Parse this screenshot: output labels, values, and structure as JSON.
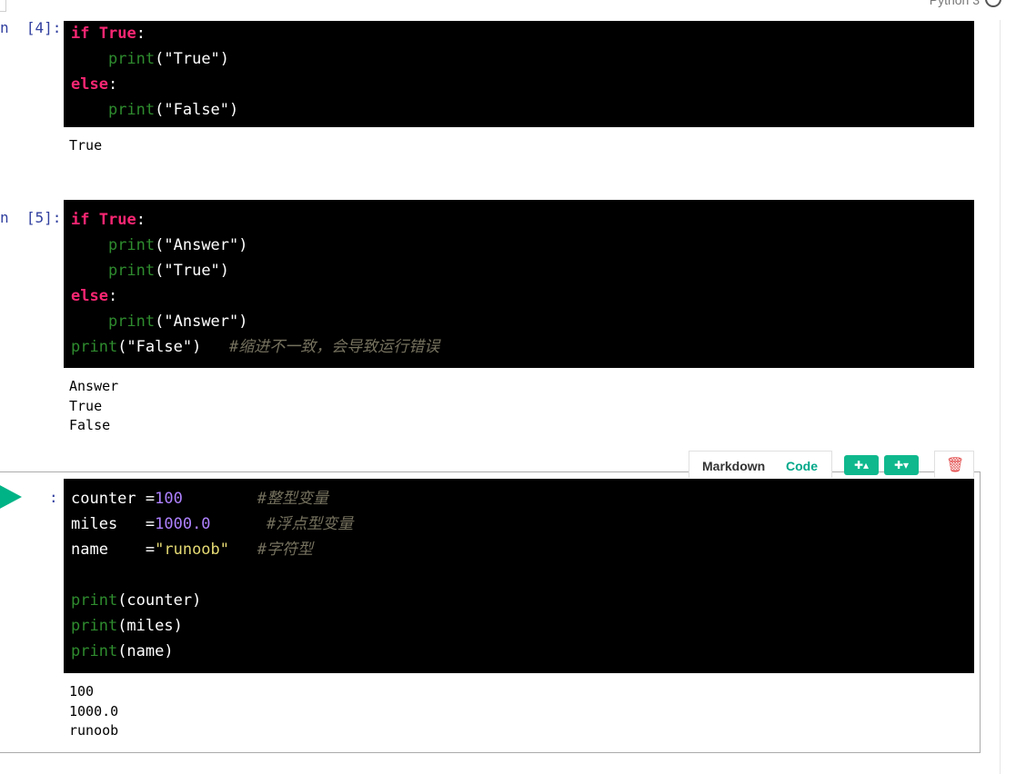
{
  "kernel": {
    "name": "Python 3"
  },
  "cells": [
    {
      "prompt": "n  [4]:",
      "code": [
        [
          [
            "kw",
            "if"
          ],
          [
            "punc",
            " "
          ],
          [
            "kw",
            "True"
          ],
          [
            "punc",
            ":"
          ]
        ],
        [
          [
            "punc",
            "    "
          ],
          [
            "fn",
            "print"
          ],
          [
            "punc",
            "(\"True\")"
          ]
        ],
        [
          [
            "kw",
            "else"
          ],
          [
            "punc",
            ":"
          ]
        ],
        [
          [
            "punc",
            "    "
          ],
          [
            "fn",
            "print"
          ],
          [
            "punc",
            "(\"False\")"
          ]
        ]
      ],
      "output": [
        "True"
      ]
    },
    {
      "prompt": "n  [5]:",
      "code": [
        [
          [
            "kw",
            "if"
          ],
          [
            "punc",
            " "
          ],
          [
            "kw",
            "True"
          ],
          [
            "punc",
            ":"
          ]
        ],
        [
          [
            "punc",
            "    "
          ],
          [
            "fn",
            "print"
          ],
          [
            "punc",
            "(\"Answer\")"
          ]
        ],
        [
          [
            "punc",
            "    "
          ],
          [
            "fn",
            "print"
          ],
          [
            "punc",
            "(\"True\")"
          ]
        ],
        [
          [
            "kw",
            "else"
          ],
          [
            "punc",
            ":"
          ]
        ],
        [
          [
            "punc",
            "    "
          ],
          [
            "fn",
            "print"
          ],
          [
            "punc",
            "(\"Answer\")"
          ]
        ],
        [
          [
            "fn",
            "print"
          ],
          [
            "punc",
            "(\"False\")   "
          ],
          [
            "cmt",
            "#缩进不一致，会导致运行错误"
          ]
        ]
      ],
      "output": [
        "Answer",
        "True",
        "False"
      ]
    },
    {
      "prompt": ":",
      "code": [
        [
          [
            "punc",
            "counter ="
          ],
          [
            "num",
            "100"
          ],
          [
            "punc",
            "        "
          ],
          [
            "cmt",
            "#整型变量"
          ]
        ],
        [
          [
            "punc",
            "miles   ="
          ],
          [
            "num",
            "1000.0"
          ],
          [
            "punc",
            "      "
          ],
          [
            "cmt",
            "#浮点型变量"
          ]
        ],
        [
          [
            "punc",
            "name    ="
          ],
          [
            "str",
            "\"runoob\""
          ],
          [
            "punc",
            "   "
          ],
          [
            "cmt",
            "#字符型"
          ]
        ],
        [
          [
            "punc",
            " "
          ]
        ],
        [
          [
            "fn",
            "print"
          ],
          [
            "punc",
            "(counter)"
          ]
        ],
        [
          [
            "fn",
            "print"
          ],
          [
            "punc",
            "(miles)"
          ]
        ],
        [
          [
            "fn",
            "print"
          ],
          [
            "punc",
            "(name)"
          ]
        ]
      ],
      "output": [
        "100",
        "1000.0",
        "runoob"
      ]
    }
  ],
  "toolbar": {
    "markdown_label": "Markdown",
    "code_label": "Code",
    "insert_above_label": "✚▴",
    "insert_below_label": "✚▾",
    "delete_glyph": "🗑"
  },
  "colors": {
    "keyword": "#f92672",
    "function": "#2e8b2e",
    "number": "#ae81ff",
    "string": "#e6db74",
    "comment": "#75715e",
    "accent": "#0fb88d"
  }
}
